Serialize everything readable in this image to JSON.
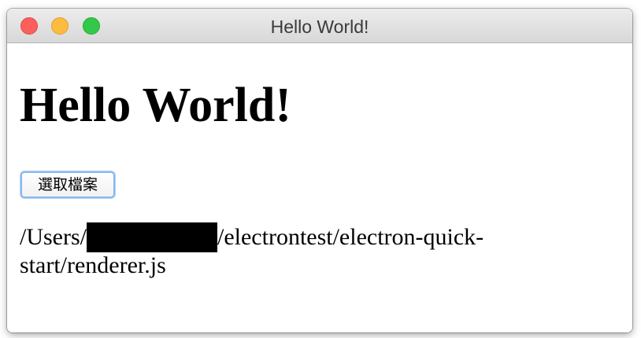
{
  "window": {
    "title": "Hello World!",
    "controls": [
      "close",
      "minimize",
      "maximize"
    ]
  },
  "main": {
    "heading": "Hello World!",
    "button_label": "選取檔案",
    "path": {
      "prefix": "/Users/",
      "redacted": true,
      "suffix": "/electrontest/electron-quick-start/renderer.js"
    }
  },
  "colors": {
    "close": "#fc605c",
    "minimize": "#fdbc40",
    "maximize": "#34c84a",
    "button_focus_ring": "#86b7ef"
  }
}
